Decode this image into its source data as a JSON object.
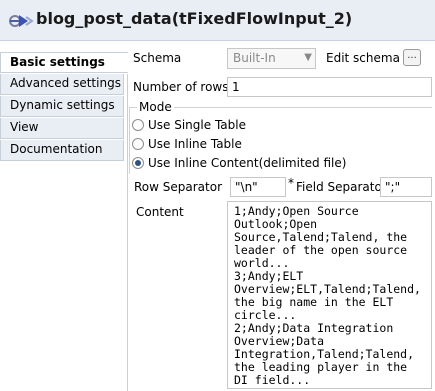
{
  "window": {
    "title": "blog_post_data(tFixedFlowInput_2)"
  },
  "sidebar": {
    "items": [
      {
        "label": "Basic settings",
        "active": true
      },
      {
        "label": "Advanced settings"
      },
      {
        "label": "Dynamic settings"
      },
      {
        "label": "View"
      },
      {
        "label": "Documentation"
      }
    ]
  },
  "settings": {
    "schema_label": "Schema",
    "schema_value": "Built-In",
    "edit_schema_label": "Edit schema",
    "edit_schema_button": "...",
    "rows_label": "Number of rows",
    "rows_value": "1",
    "mode": {
      "title": "Mode",
      "options": [
        "Use Single Table",
        "Use Inline Table",
        "Use Inline Content(delimited file)"
      ],
      "selected": "Use Inline Content(delimited file)"
    },
    "row_separator_label": "Row Separator",
    "row_separator_value": "\"\\n\"",
    "field_separator_asterisk": "*",
    "field_separator_label": "Field Separator",
    "field_separator_value": "\";\"",
    "content_label": "Content",
    "content_value": "1;Andy;Open Source\nOutlook;Open\nSource,Talend;Talend, the\nleader of the open source\nworld...\n3;Andy;ELT\nOverview;ELT,Talend;Talend,\nthe big name in the ELT\ncircle...\n2;Andy;Data Integration\nOverview;Data\nIntegration,Talend;Talend,\nthe leading player in the\nDI field..."
  }
}
